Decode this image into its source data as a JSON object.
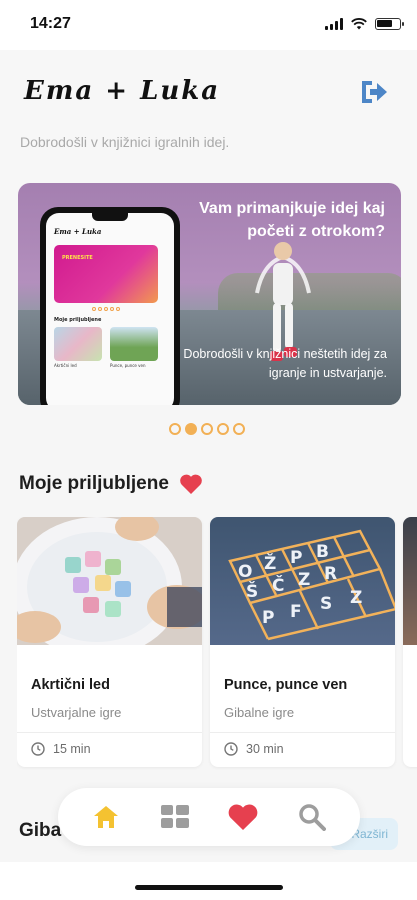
{
  "status_bar": {
    "time": "14:27"
  },
  "header": {
    "title": "Ema + Luka",
    "subtitle": "Dobrodošli v knjižnici igralnih idej.",
    "logout_icon": "logout-icon"
  },
  "banner": {
    "headline": "Vam primanjkuje idej kaj početi z otrokom?",
    "caption": "Dobrodošli v knjižnici neštetih idej za igranje in ustvarjanje.",
    "mockup": {
      "title": "Ema + Luka",
      "section": "Moje priljubljene",
      "banner_text": "PRENESITE",
      "cards": [
        "Akrtični led",
        "Punce, punce ven"
      ]
    },
    "slides_total": 5,
    "active_slide": 2
  },
  "favorites": {
    "title": "Moje priljubljene",
    "cards": [
      {
        "title": "Akrtični led",
        "category": "Ustvarjalne igre",
        "duration": "15 min",
        "image": "ice-cubes-photo"
      },
      {
        "title": "Punce, punce ven",
        "category": "Gibalne igre",
        "duration": "30 min",
        "image": "hopscotch-photo"
      }
    ]
  },
  "section2": {
    "title": "Giba",
    "expand_label": "Razširi"
  },
  "nav": {
    "items": [
      {
        "name": "home",
        "icon": "home-icon",
        "color": "#f4c231"
      },
      {
        "name": "categories",
        "icon": "grid-icon",
        "color": "#9d9d9d"
      },
      {
        "name": "favorites",
        "icon": "heart-icon",
        "color": "#e6404f"
      },
      {
        "name": "search",
        "icon": "search-icon",
        "color": "#9d9d9d"
      }
    ]
  },
  "colors": {
    "accent": "#f2b055",
    "heart": "#e6404f",
    "logout": "#4d86c7"
  }
}
